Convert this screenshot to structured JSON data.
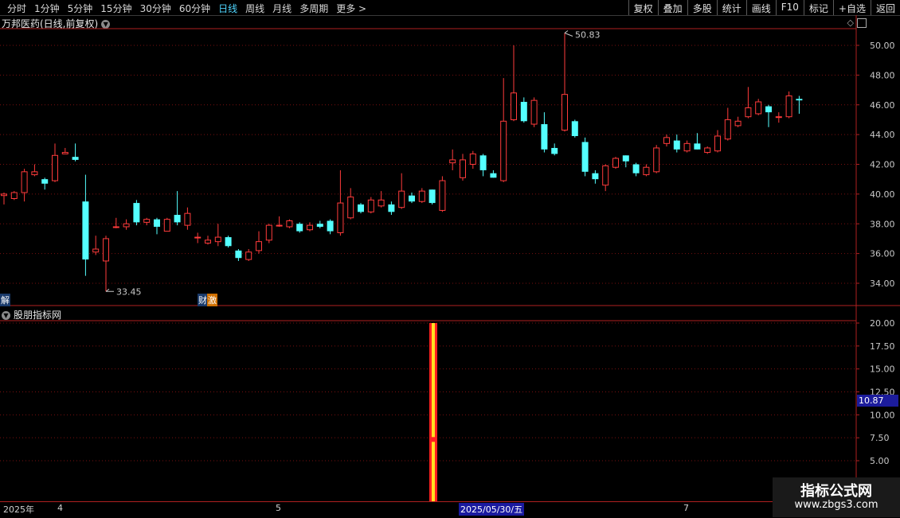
{
  "toolbar": {
    "periods": [
      "分时",
      "1分钟",
      "5分钟",
      "15分钟",
      "30分钟",
      "60分钟",
      "日线",
      "周线",
      "月线",
      "多周期",
      "更多 >"
    ],
    "active_period": "日线",
    "right_buttons": [
      "复权",
      "叠加",
      "多股",
      "统计",
      "画线",
      "F10",
      "标记",
      "+自选",
      "返回"
    ]
  },
  "chart": {
    "title": "万邦医药(日线,前复权)",
    "high_label": "50.83",
    "low_label": "33.45",
    "badge_left": "解",
    "badge_mid_1": "财",
    "badge_mid_2": "激",
    "price_axis": [
      "50.00",
      "48.00",
      "46.00",
      "44.00",
      "42.00",
      "40.00",
      "38.00",
      "36.00",
      "34.00"
    ]
  },
  "indicator": {
    "title": "股朋指标网",
    "axis": [
      "20.00",
      "17.50",
      "15.00",
      "12.50",
      "10.00",
      "7.50",
      "5.00"
    ],
    "current_value": "10.87"
  },
  "date_axis": {
    "year": "2025年",
    "m4": "4",
    "m5": "5",
    "selected": "2025/05/30/五",
    "m7": "7"
  },
  "watermark": {
    "line1": "指标公式网",
    "line2": "www.zbgs3.com"
  },
  "colors": {
    "up": "#ff3b3b",
    "down": "#54ffff",
    "bg": "#000000",
    "grid": "#7a1010"
  },
  "chart_data": {
    "type": "candlestick",
    "price_range": [
      33,
      51.5
    ],
    "candles": [
      [
        39.9,
        40.0,
        39.3,
        40.1
      ],
      [
        39.7,
        40.1,
        39.6,
        40.2
      ],
      [
        40.1,
        41.5,
        39.5,
        41.7
      ],
      [
        41.3,
        41.5,
        41.2,
        42.0
      ],
      [
        41.0,
        40.7,
        40.3,
        41.1
      ],
      [
        40.9,
        42.6,
        40.8,
        43.4
      ],
      [
        42.7,
        42.8,
        42.7,
        43.1
      ],
      [
        42.5,
        42.3,
        42.2,
        43.4
      ],
      [
        39.5,
        35.6,
        34.5,
        41.3
      ],
      [
        36.1,
        36.3,
        35.9,
        37.2
      ],
      [
        35.5,
        37.0,
        33.45,
        37.2
      ],
      [
        37.8,
        37.8,
        37.7,
        38.4
      ],
      [
        37.8,
        38.0,
        37.6,
        38.3
      ],
      [
        39.4,
        38.1,
        37.9,
        39.6
      ],
      [
        38.1,
        38.3,
        37.9,
        38.4
      ],
      [
        38.3,
        37.8,
        37.3,
        38.4
      ],
      [
        37.5,
        38.3,
        37.5,
        38.4
      ],
      [
        38.6,
        38.1,
        37.9,
        40.2
      ],
      [
        37.9,
        38.7,
        37.6,
        39.1
      ],
      [
        37.1,
        37.1,
        36.7,
        37.4
      ],
      [
        36.7,
        36.9,
        36.6,
        37.2
      ],
      [
        36.8,
        37.1,
        36.5,
        38.0
      ],
      [
        37.1,
        36.5,
        36.4,
        37.2
      ],
      [
        36.2,
        35.7,
        35.5,
        36.3
      ],
      [
        35.6,
        36.1,
        35.5,
        36.3
      ],
      [
        36.2,
        36.8,
        36.0,
        37.5
      ],
      [
        36.9,
        37.9,
        36.7,
        38.0
      ],
      [
        37.9,
        37.9,
        37.8,
        38.5
      ],
      [
        37.8,
        38.2,
        37.7,
        38.3
      ],
      [
        38.0,
        37.5,
        37.4,
        38.1
      ],
      [
        37.6,
        37.9,
        37.5,
        38.1
      ],
      [
        38.0,
        37.8,
        37.7,
        38.2
      ],
      [
        38.2,
        37.5,
        37.3,
        38.3
      ],
      [
        37.4,
        39.4,
        37.2,
        41.6
      ],
      [
        38.4,
        39.8,
        38.3,
        40.4
      ],
      [
        39.3,
        38.8,
        38.7,
        39.4
      ],
      [
        38.8,
        39.6,
        38.7,
        39.8
      ],
      [
        39.2,
        39.6,
        39.1,
        40.2
      ],
      [
        39.3,
        38.8,
        38.6,
        39.5
      ],
      [
        39.1,
        40.2,
        39.0,
        41.4
      ],
      [
        39.9,
        39.5,
        39.4,
        40.1
      ],
      [
        39.5,
        40.2,
        39.4,
        40.4
      ],
      [
        40.3,
        39.4,
        39.3,
        40.3
      ],
      [
        38.9,
        40.9,
        38.8,
        41.2
      ],
      [
        42.1,
        42.3,
        41.6,
        43.0
      ],
      [
        41.1,
        42.3,
        40.9,
        42.7
      ],
      [
        42.0,
        42.7,
        41.7,
        42.9
      ],
      [
        42.6,
        41.6,
        41.2,
        42.7
      ],
      [
        41.4,
        41.1,
        41.1,
        41.6
      ],
      [
        40.9,
        44.9,
        40.8,
        47.8
      ],
      [
        45.0,
        46.8,
        44.9,
        50.0
      ],
      [
        46.2,
        44.9,
        44.8,
        46.5
      ],
      [
        44.7,
        46.3,
        44.5,
        46.5
      ],
      [
        44.7,
        43.0,
        42.8,
        45.5
      ],
      [
        43.1,
        42.7,
        42.6,
        43.4
      ],
      [
        44.3,
        46.7,
        44.2,
        50.83
      ],
      [
        44.9,
        43.9,
        43.8,
        45.0
      ],
      [
        43.5,
        41.5,
        41.2,
        43.8
      ],
      [
        41.4,
        41.0,
        40.7,
        41.6
      ],
      [
        40.6,
        41.9,
        40.2,
        42.0
      ],
      [
        41.8,
        42.4,
        41.7,
        42.5
      ],
      [
        42.6,
        42.2,
        41.8,
        42.6
      ],
      [
        42.0,
        41.4,
        41.2,
        42.1
      ],
      [
        41.3,
        41.8,
        41.2,
        42.0
      ],
      [
        41.5,
        43.1,
        41.4,
        43.3
      ],
      [
        43.4,
        43.8,
        43.2,
        44.0
      ],
      [
        43.6,
        43.0,
        42.8,
        44.0
      ],
      [
        42.9,
        43.4,
        42.8,
        43.6
      ],
      [
        43.4,
        43.0,
        43.0,
        44.1
      ],
      [
        42.8,
        43.1,
        42.7,
        43.2
      ],
      [
        42.9,
        43.9,
        42.8,
        44.3
      ],
      [
        43.7,
        45.0,
        43.6,
        45.8
      ],
      [
        44.6,
        44.9,
        44.5,
        45.2
      ],
      [
        45.2,
        45.8,
        45.1,
        47.2
      ],
      [
        45.4,
        46.2,
        45.3,
        46.4
      ],
      [
        45.9,
        45.5,
        44.5,
        46.0
      ],
      [
        45.2,
        45.2,
        44.8,
        45.5
      ],
      [
        45.2,
        46.6,
        45.1,
        46.9
      ],
      [
        46.4,
        46.3,
        45.4,
        46.6
      ]
    ],
    "indicator_bar": {
      "date": "2025/05/30/五",
      "value": 20,
      "inner_value": 10.87
    }
  }
}
